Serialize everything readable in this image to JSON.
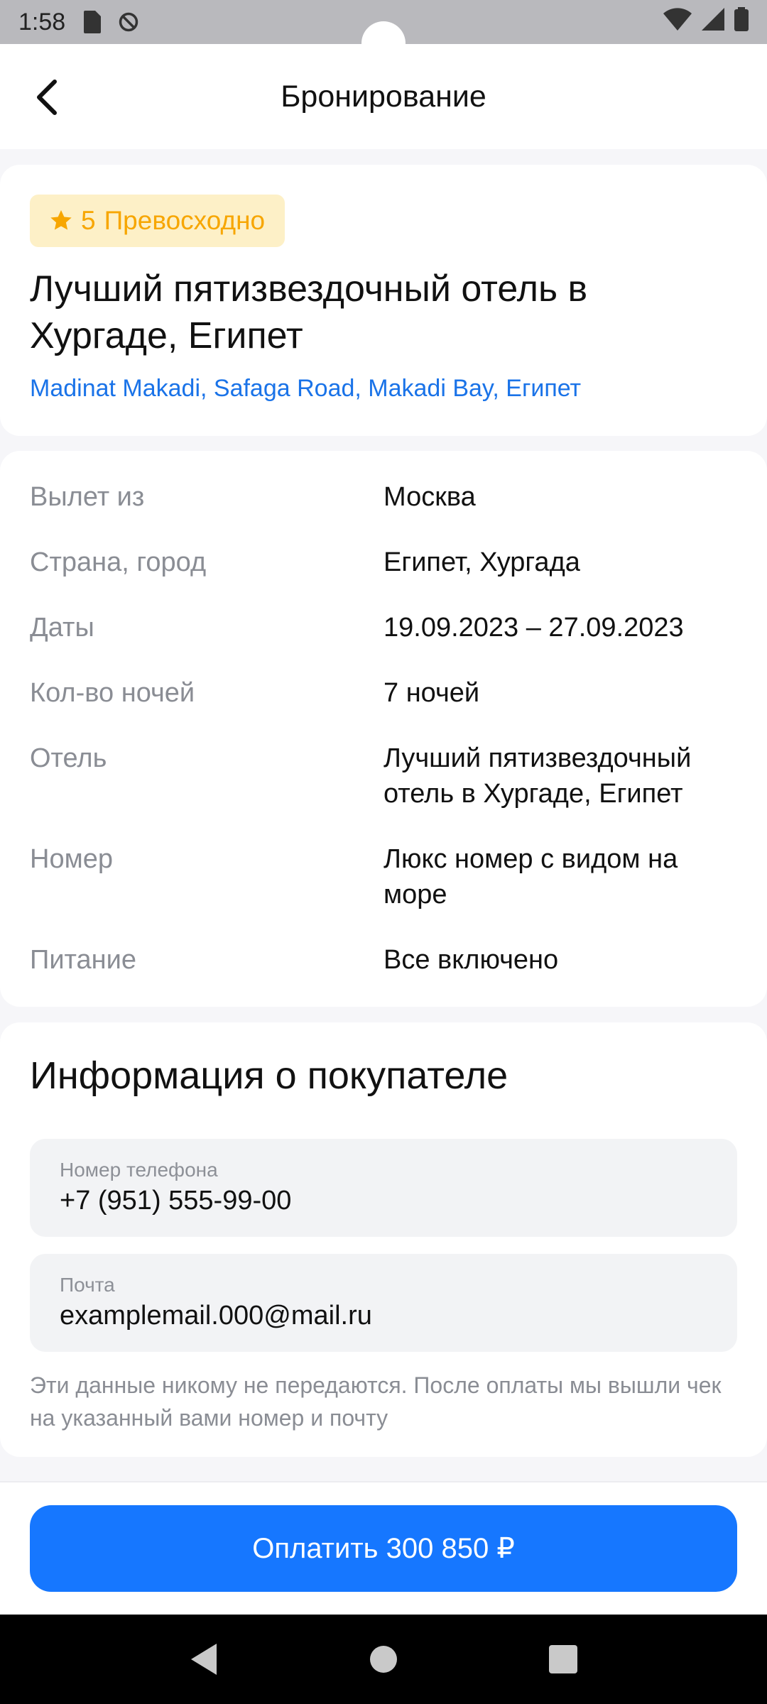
{
  "status_bar": {
    "time": "1:58",
    "icons": [
      "sd-card-icon",
      "no-disturb-icon",
      "wifi-icon",
      "signal-icon",
      "battery-icon"
    ]
  },
  "header": {
    "title": "Бронирование",
    "back_icon": "back-arrow-icon"
  },
  "hotel": {
    "rating_value": "5",
    "rating_text": "Превосходно",
    "name": "Лучший пятизвездочный отель в Хургаде, Египет",
    "address": "Madinat Makadi, Safaga Road, Makadi Bay, Египет"
  },
  "details": [
    {
      "label": "Вылет из",
      "value": "Москва"
    },
    {
      "label": "Страна, город",
      "value": "Египет, Хургада"
    },
    {
      "label": "Даты",
      "value": "19.09.2023 – 27.09.2023"
    },
    {
      "label": "Кол-во ночей",
      "value": "7 ночей"
    },
    {
      "label": "Отель",
      "value": "Лучший пятизвездочный отель в Хургаде, Египет"
    },
    {
      "label": "Номер",
      "value": "Люкс номер с видом на море"
    },
    {
      "label": "Питание",
      "value": "Все включено"
    }
  ],
  "buyer": {
    "title": "Информация о покупателе",
    "phone_label": "Номер телефона",
    "phone_value": "+7 (951) 555-99-00",
    "email_label": "Почта",
    "email_value": "examplemail.000@mail.ru",
    "note": "Эти данные никому не передаются. После оплаты мы вышли чек на указанный вами номер и почту"
  },
  "footer": {
    "pay_button": "Оплатить 300 850 ₽"
  },
  "colors": {
    "accent": "#1677ff",
    "rating": "#f7a600",
    "rating_bg": "#fdf0c7",
    "link": "#1a73e8"
  }
}
